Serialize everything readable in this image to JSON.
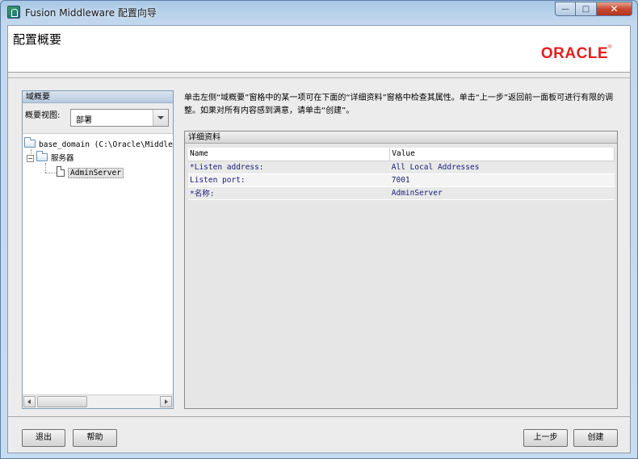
{
  "window": {
    "title": "Fusion Middleware 配置向导"
  },
  "header": {
    "page_title": "配置概要",
    "logo_text": "ORACLE"
  },
  "summary_panel": {
    "title": "域概要",
    "view_label": "概要视图:",
    "view_selected": "部署"
  },
  "tree": {
    "root": "base_domain (C:\\Oracle\\Middleware\\user_projects\\domains\\base_domain)",
    "servers_node": "服务器",
    "server_leaf": "AdminServer"
  },
  "description": "单击左侧“域概要”窗格中的某一项可在下面的“详细资料”窗格中检查其属性。单击“上一步”返回前一面板可进行有限的调整。如果对所有内容感到满意，请单击“创建”。",
  "details": {
    "title": "详细资料",
    "columns": [
      "Name",
      "Value"
    ],
    "rows": [
      {
        "name": "*Listen address:",
        "value": "All Local Addresses"
      },
      {
        "name": "Listen port:",
        "value": "7001"
      },
      {
        "name": "*名称:",
        "value": "AdminServer"
      }
    ]
  },
  "buttons": {
    "exit": "退出",
    "help": "帮助",
    "back": "上一步",
    "create": "创建"
  }
}
